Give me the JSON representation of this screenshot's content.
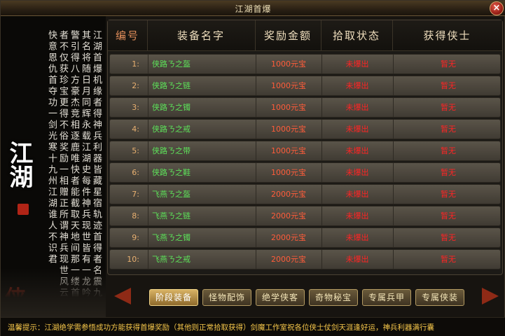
{
  "window": {
    "title": "江湖首爆",
    "close_label": "×"
  },
  "left_panel": {
    "poem": "江湖首爆机缘者得神兵利器皆藏星宿轨迹首得者名震九州其名将随日月同辉永载江湖史每件神兵现世皆有一龙吟示警引得八方豪杰竞相逐鹿唯快者能截取天地间那一缕首夺者不仅获珍宝更得不俗奖励一相赠正所谓神兵现世风云动快意恩仇首夺功一剑光寒十九州江湖谁人不识君",
    "logo": "江湖",
    "signature": "侠"
  },
  "table": {
    "headers": [
      "编号",
      "装备名字",
      "奖励金额",
      "拾取状态",
      "获得侠士"
    ],
    "rows": [
      {
        "num": "1:",
        "name": "侠路ㄋ之盔",
        "reward": "1000元宝",
        "status": "未爆出",
        "winner": "暂无"
      },
      {
        "num": "2:",
        "name": "侠路ㄋ之链",
        "reward": "1000元宝",
        "status": "未爆出",
        "winner": "暂无"
      },
      {
        "num": "3:",
        "name": "侠路ㄋ之镯",
        "reward": "1000元宝",
        "status": "未爆出",
        "winner": "暂无"
      },
      {
        "num": "4:",
        "name": "侠路ㄋ之戒",
        "reward": "1000元宝",
        "status": "未爆出",
        "winner": "暂无"
      },
      {
        "num": "5:",
        "name": "侠路ㄋ之带",
        "reward": "1000元宝",
        "status": "未爆出",
        "winner": "暂无"
      },
      {
        "num": "6:",
        "name": "侠路ㄋ之鞋",
        "reward": "1000元宝",
        "status": "未爆出",
        "winner": "暂无"
      },
      {
        "num": "7:",
        "name": "飞燕ㄋ之盔",
        "reward": "2000元宝",
        "status": "未爆出",
        "winner": "暂无"
      },
      {
        "num": "8:",
        "name": "飞燕ㄋ之链",
        "reward": "2000元宝",
        "status": "未爆出",
        "winner": "暂无"
      },
      {
        "num": "9:",
        "name": "飞燕ㄋ之镯",
        "reward": "2000元宝",
        "status": "未爆出",
        "winner": "暂无"
      },
      {
        "num": "10:",
        "name": "飞燕ㄋ之戒",
        "reward": "2000元宝",
        "status": "未爆出",
        "winner": "暂无"
      }
    ]
  },
  "tabs": [
    {
      "label": "阶段装备",
      "active": true
    },
    {
      "label": "怪物配饰",
      "active": false
    },
    {
      "label": "绝学侠客",
      "active": false
    },
    {
      "label": "奇物秘宝",
      "active": false
    },
    {
      "label": "专属兵甲",
      "active": false
    },
    {
      "label": "专属侠装",
      "active": false
    }
  ],
  "footer": {
    "notice": "温馨提示：江湖绝学需参悟成功方能获得首爆奖励（其他则正常拾取获得）剑魔工作室祝各位侠士仗剑天涯逢好运，神兵利器满行囊"
  },
  "colors": {
    "name_green": "#5de25a",
    "status_red": "#ff2424",
    "notice_gold": "#f5c64a"
  }
}
